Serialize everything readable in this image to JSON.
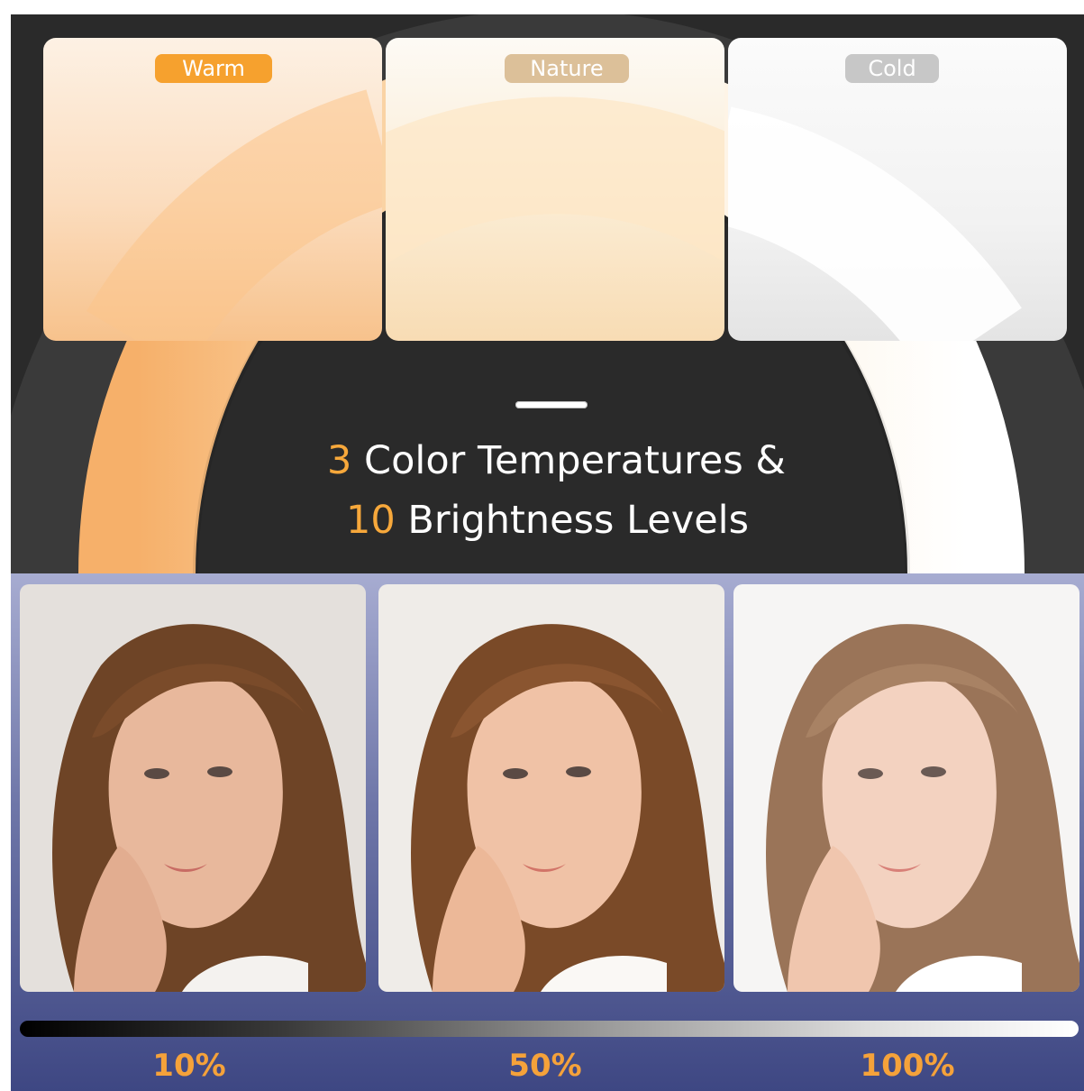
{
  "temperatures": [
    {
      "label": "Warm",
      "color": "#f6a12e"
    },
    {
      "label": "Nature",
      "color": "#dcc099"
    },
    {
      "label": "Cold",
      "color": "#c7c7c7"
    }
  ],
  "headline": {
    "line1_num": "3",
    "line1_text": " Color Temperatures &",
    "line2_num": "10",
    "line2_text": " Brightness Levels"
  },
  "brightness_levels": [
    {
      "label": "10%",
      "value": 0.1
    },
    {
      "label": "50%",
      "value": 0.5
    },
    {
      "label": "100%",
      "value": 1.0
    }
  ],
  "colors": {
    "accent": "#f7a83b",
    "background_top": "#2a2a2a",
    "background_bottom": "#5a6296"
  }
}
